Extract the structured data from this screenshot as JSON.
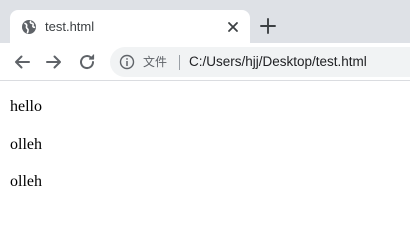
{
  "tab": {
    "title": "test.html",
    "favicon": "globe-icon",
    "close_icon": "close-icon",
    "new_tab_icon": "plus-icon"
  },
  "toolbar": {
    "back_icon": "arrow-left-icon",
    "forward_icon": "arrow-right-icon",
    "reload_icon": "reload-icon",
    "info_icon": "info-icon",
    "site_label": "文件",
    "url": "C:/Users/hjj/Desktop/test.html"
  },
  "content": {
    "lines": [
      "hello",
      "olleh",
      "olleh"
    ]
  },
  "colors": {
    "tabstrip_bg": "#dee1e6",
    "omnibox_bg": "#f1f3f4",
    "icon_gray": "#5f6368"
  }
}
